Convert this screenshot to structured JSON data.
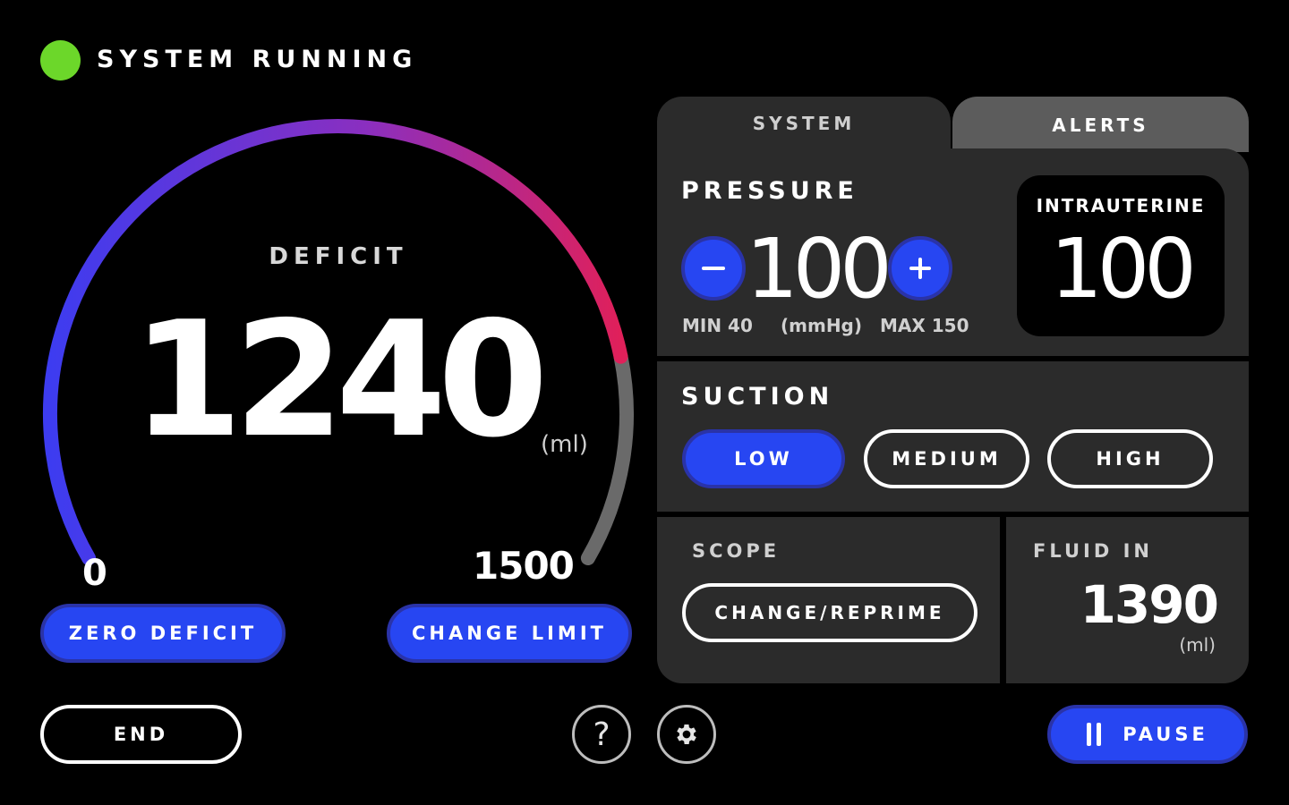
{
  "status": {
    "text": "SYSTEM RUNNING",
    "color": "#6cd72a"
  },
  "deficit": {
    "label": "DEFICIT",
    "value": "1240",
    "unit": "(ml)",
    "min": "0",
    "max": "1500",
    "gauge_fraction": 0.827
  },
  "buttons": {
    "zero_deficit": "ZERO DEFICIT",
    "change_limit": "CHANGE LIMIT",
    "end": "END",
    "help": "?",
    "pause": "PAUSE"
  },
  "tabs": {
    "system": "SYSTEM",
    "alerts": "ALERTS"
  },
  "pressure": {
    "title": "PRESSURE",
    "value": "100",
    "min_label": "MIN 40",
    "unit": "(mmHg)",
    "max_label": "MAX 150",
    "intrauterine_label": "INTRAUTERINE",
    "intrauterine_value": "100"
  },
  "suction": {
    "title": "SUCTION",
    "options": [
      "LOW",
      "MEDIUM",
      "HIGH"
    ],
    "selected": "LOW"
  },
  "scope": {
    "title": "SCOPE",
    "button": "CHANGE/REPRIME"
  },
  "fluid_in": {
    "title": "FLUID IN",
    "value": "1390",
    "unit": "(ml)"
  },
  "colors": {
    "accent": "#2746f2",
    "panel": "#2b2b2b",
    "alerts_tab": "#5c5c5c",
    "gauge_start": "#3d3cf0",
    "gauge_end": "#e0205a",
    "gauge_track": "#6a6a6a"
  },
  "icons": {
    "settings": "gear-icon",
    "pause": "pause-icon",
    "minus": "minus-icon",
    "plus": "plus-icon",
    "status": "status-dot-icon"
  }
}
